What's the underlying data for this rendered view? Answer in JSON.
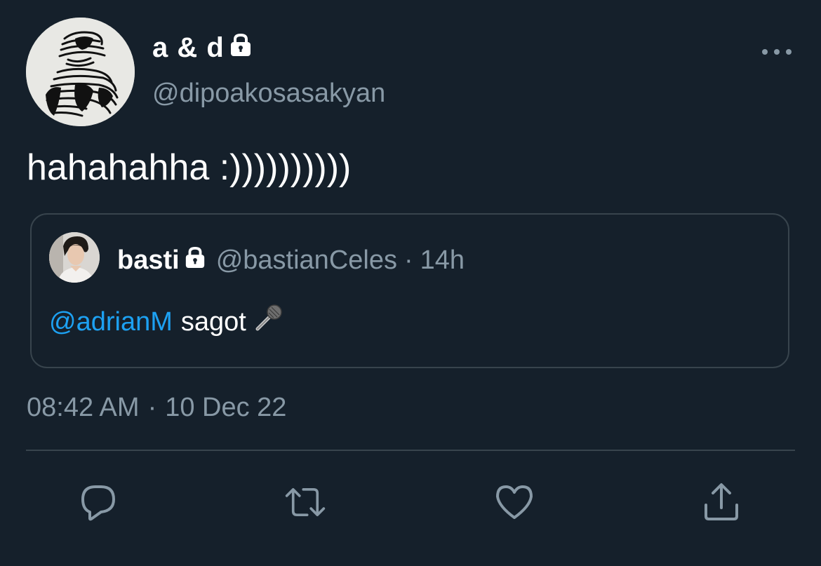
{
  "tweet": {
    "author": {
      "display_name": "a & d",
      "handle": "@dipoakosasakyan",
      "avatar_icon": "abstract-ink-drawing-avatar",
      "lock_icon": "lock-icon"
    },
    "more_icon": "more-horizontal-icon",
    "text": "hahahahha :))))))))))",
    "quoted": {
      "display_name": "basti",
      "handle": "@bastianCeles",
      "separator": "·",
      "time_ago": "14h",
      "mention": "@adrianM",
      "text": "sagot",
      "emoji_icon": "microphone-icon"
    },
    "time": "08:42 AM",
    "separator": "·",
    "date": "10 Dec 22"
  },
  "actions": [
    {
      "name": "reply",
      "icon": "reply-icon"
    },
    {
      "name": "retweet",
      "icon": "retweet-icon"
    },
    {
      "name": "like",
      "icon": "heart-icon"
    },
    {
      "name": "share",
      "icon": "share-icon"
    }
  ],
  "colors": {
    "background": "#15202b",
    "text_primary": "#ffffff",
    "text_secondary": "#8899a6",
    "border": "#38444d",
    "accent": "#1da1f2"
  }
}
